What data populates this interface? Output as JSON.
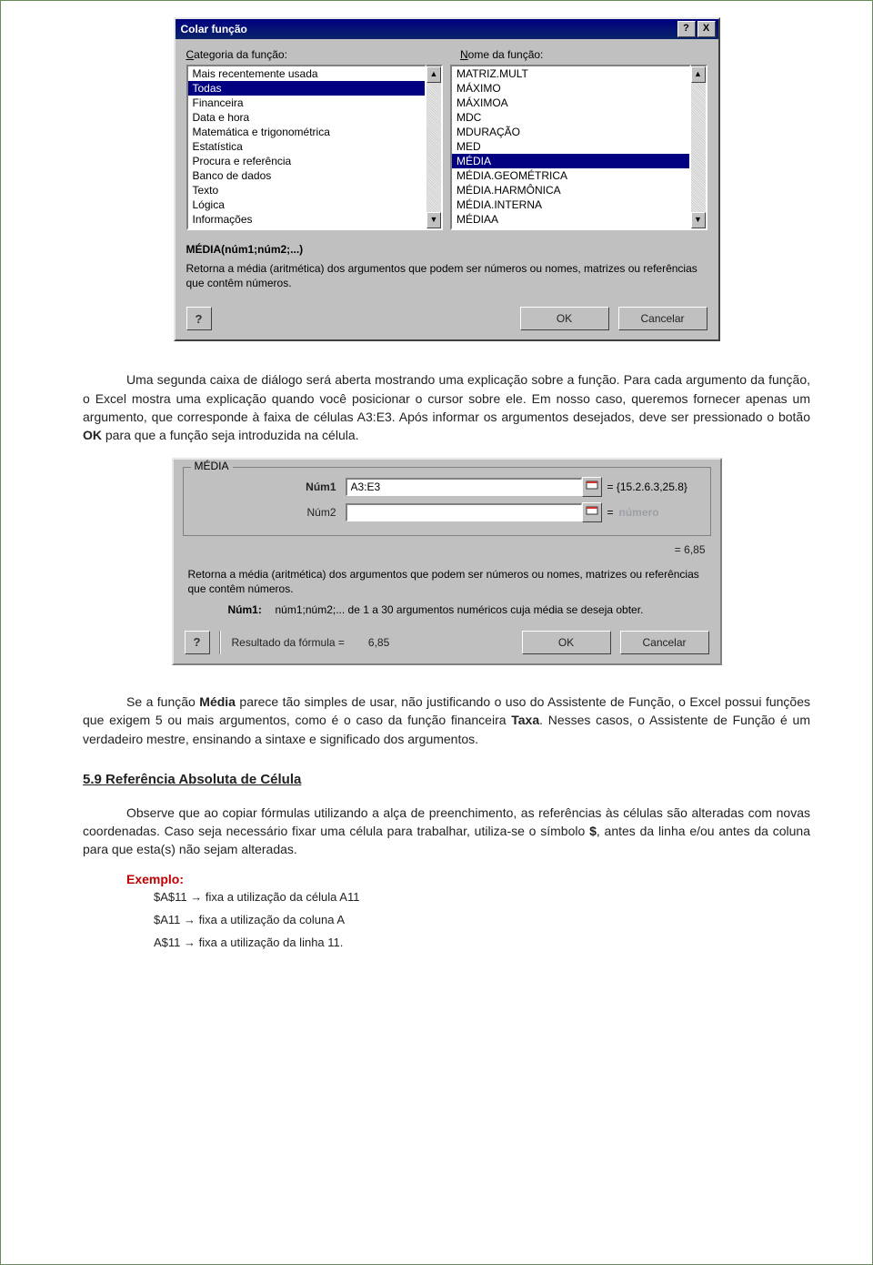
{
  "dialog1": {
    "title": "Colar função",
    "help_icon": "?",
    "close_icon": "X",
    "category_label_pre": "C",
    "category_label_post": "ategoria da função:",
    "name_label_pre": "N",
    "name_label_post": "ome da função:",
    "categories": [
      "Mais recentemente usada",
      "Todas",
      "Financeira",
      "Data e hora",
      "Matemática e trigonométrica",
      "Estatística",
      "Procura e referência",
      "Banco de dados",
      "Texto",
      "Lógica",
      "Informações"
    ],
    "categories_selected": 1,
    "functions": [
      "MATRIZ.MULT",
      "MÁXIMO",
      "MÁXIMOA",
      "MDC",
      "MDURAÇÃO",
      "MED",
      "MÉDIA",
      "MÉDIA.GEOMÉTRICA",
      "MÉDIA.HARMÔNICA",
      "MÉDIA.INTERNA",
      "MÉDIAA"
    ],
    "functions_selected": 6,
    "signature": "MÉDIA(núm1;núm2;...)",
    "description": "Retorna a média (aritmética) dos argumentos que podem ser números ou nomes, matrizes ou referências que contêm números.",
    "btn_ok": "OK",
    "btn_cancel": "Cancelar"
  },
  "body": {
    "p1_a": "Uma segunda caixa de diálogo será aberta mostrando uma explicação sobre a função. Para cada argumento da função, o Excel mostra uma explicação quando você posicionar o cursor sobre ele. Em nosso caso, queremos fornecer apenas um argumento, que corresponde à faixa de células A3:E3. Após informar os argumentos desejados, deve ser pressionado o botão ",
    "p1_ok": "OK",
    "p1_b": " para que a função seja introduzida na célula.",
    "p2_a": "Se a função ",
    "p2_media": "Média",
    "p2_b": " parece tão simples de usar, não justificando o uso do Assistente de Função, o Excel possui funções que exigem 5 ou mais argumentos, como é o caso da função financeira ",
    "p2_taxa": "Taxa",
    "p2_c": ". Nesses casos, o Assistente de Função é um verdadeiro mestre, ensinando a sintaxe e significado dos argumentos.",
    "section_heading": "5.9  Referência Absoluta de Célula",
    "p3_a": "Observe que ao copiar fórmulas utilizando a alça de preenchimento, as referências às células são alteradas com novas coordenadas. Caso seja necessário fixar uma célula para trabalhar, utiliza-se o símbolo ",
    "p3_dollar": "$",
    "p3_b": ", antes da linha e/ou antes da coluna para que esta(s) não sejam alteradas.",
    "exemplo_label": "Exemplo:",
    "ex1": "$A$11 → fixa a utilização da célula A11",
    "ex2": "$A11 → fixa a utilização da coluna A",
    "ex3": "A$11 → fixa a utilização da linha 11."
  },
  "dialog2": {
    "group_title": "MÉDIA",
    "arg1_label": "Núm1",
    "arg1_value": "A3:E3",
    "arg1_result": "= {15.2.6.3,25.8}",
    "arg2_label": "Núm2",
    "arg2_value": "",
    "arg2_hint": "número",
    "mid_result": "=  6,85",
    "description": "Retorna a média (aritmética) dos argumentos que podem ser números ou nomes, matrizes ou referências que contêm números.",
    "arg_help_lead": "Núm1:",
    "arg_help_text": "núm1;núm2;... de 1 a 30 argumentos numéricos cuja média se deseja obter.",
    "result_label": "Resultado da fórmula =",
    "result_value": "6,85",
    "btn_ok": "OK",
    "btn_cancel": "Cancelar"
  }
}
